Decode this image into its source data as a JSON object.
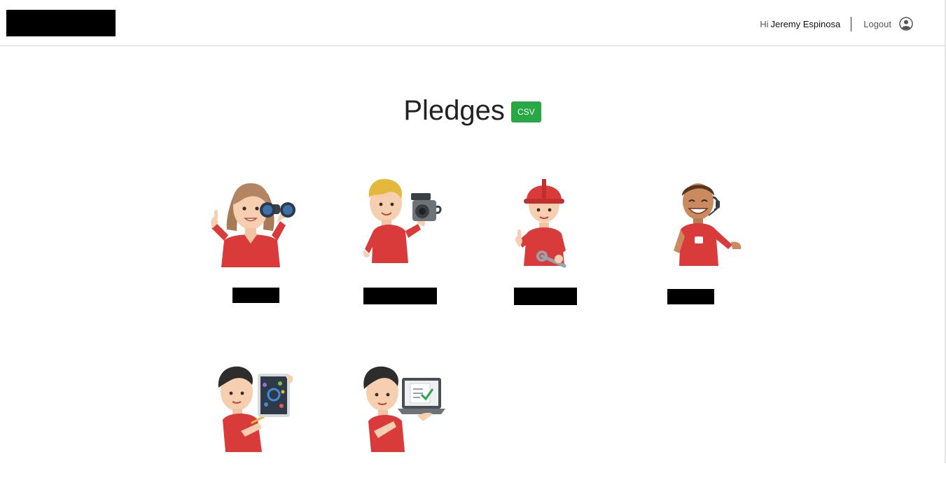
{
  "header": {
    "greeting_prefix": "Hi",
    "user_name": "Jeremy Espinosa",
    "logout_label": "Logout",
    "account_icon": "user-circle-icon"
  },
  "main": {
    "title": "Pledges",
    "csv_label": "CSV",
    "csv_color": "#28a745"
  },
  "pledges": [
    {
      "illustration": "binoculars-woman"
    },
    {
      "illustration": "video-camera-man"
    },
    {
      "illustration": "hard-hat-worker"
    },
    {
      "illustration": "headset-agent"
    },
    {
      "illustration": "tablet-designer"
    },
    {
      "illustration": "laptop-checklist-man"
    }
  ],
  "colors": {
    "brand_red": "#d93a3a",
    "skin": "#f6cfb1",
    "header_border": "#d6d6d6"
  }
}
